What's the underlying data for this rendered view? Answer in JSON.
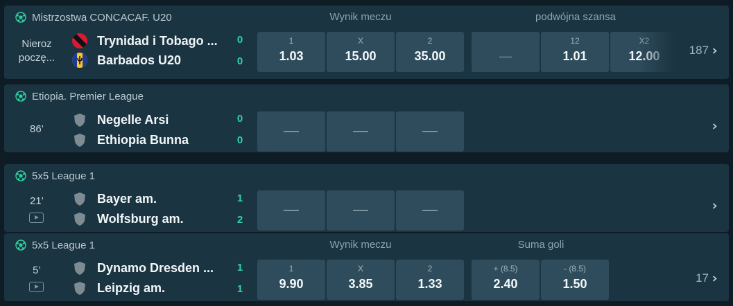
{
  "colors": {
    "accent_green": "#2fd3a3",
    "card_bg": "#1b3441",
    "odd_bg": "#2f4c5c"
  },
  "matches": [
    {
      "league": "Mistrzostwa CONCACAF. U20",
      "status_line1": "Nieroz",
      "status_line2": "poczę...",
      "team1": "Trynidad i Tobago ...",
      "team2": "Barbados U20",
      "score1": "0",
      "score2": "0",
      "group1_label": "Wynik meczu",
      "group2_label": "podwójna szansa",
      "odds": [
        {
          "label": "1",
          "value": "1.03"
        },
        {
          "label": "X",
          "value": "15.00"
        },
        {
          "label": "2",
          "value": "35.00"
        },
        {
          "label": "",
          "value": "—"
        },
        {
          "label": "12",
          "value": "1.01"
        },
        {
          "label": "X2",
          "value": "12.00"
        }
      ],
      "more": "187"
    },
    {
      "league": "Etiopia. Premier League",
      "status": "86’",
      "team1": "Negelle Arsi",
      "team2": "Ethiopia Bunna",
      "score1": "0",
      "score2": "0"
    },
    {
      "league": "5x5 League 1",
      "status": "21’",
      "team1": "Bayer am.",
      "team2": "Wolfsburg am.",
      "score1": "1",
      "score2": "2"
    },
    {
      "league": "5x5 League 1",
      "status": "5’",
      "team1": "Dynamo Dresden ...",
      "team2": "Leipzig am.",
      "score1": "1",
      "score2": "1",
      "group1_label": "Wynik meczu",
      "group2_label": "Suma goli",
      "odds": [
        {
          "label": "1",
          "value": "9.90"
        },
        {
          "label": "X",
          "value": "3.85"
        },
        {
          "label": "2",
          "value": "1.33"
        },
        {
          "label": "+ (8.5)",
          "value": "2.40"
        },
        {
          "label": "- (8.5)",
          "value": "1.50"
        }
      ],
      "more": "17"
    }
  ],
  "icons": [
    "soccer-ball-icon",
    "trinidad-flag-icon",
    "barbados-flag-icon",
    "team-shield-icon",
    "video-icon",
    "chevron-right-icon"
  ]
}
